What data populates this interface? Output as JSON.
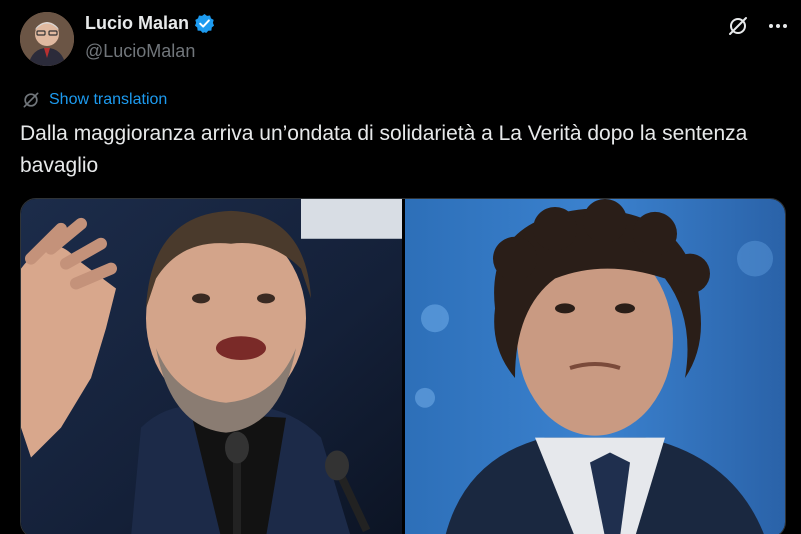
{
  "author": {
    "display_name": "Lucio Malan",
    "handle": "@LucioMalan",
    "verified": true
  },
  "actions": {
    "grok_icon": "grok-slash-icon",
    "more_icon": "more-horizontal-icon"
  },
  "translation": {
    "label": "Show translation",
    "icon": "grok-slash-icon"
  },
  "tweet": {
    "text": "Dalla maggioranza arriva un’ondata di solidarietà a La Verità dopo la sentenza bavaglio"
  },
  "media": {
    "photos": [
      "left-photo",
      "right-photo"
    ]
  },
  "colors": {
    "background": "#000000",
    "text": "#e7e9ea",
    "secondary": "#71767b",
    "accent": "#1d9bf0"
  }
}
